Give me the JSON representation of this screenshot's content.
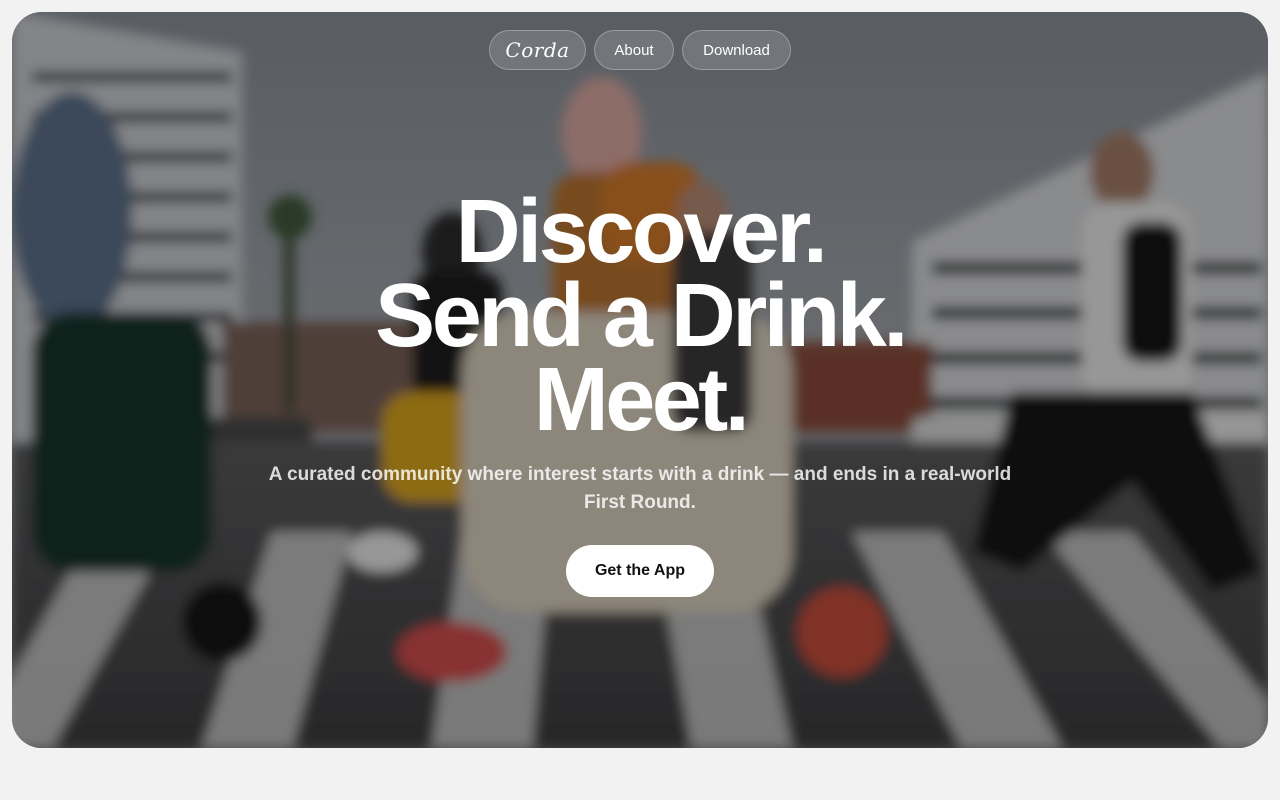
{
  "nav": {
    "logo_text": "Corda",
    "about_label": "About",
    "download_label": "Download"
  },
  "hero": {
    "headline_line1": "Discover.",
    "headline_line2": "Send a Drink.",
    "headline_line3": "Meet.",
    "subtitle": "A curated community where interest starts with a drink — and ends in a real-world First Round.",
    "cta_label": "Get the App",
    "background_image": "blurred photo of people crossing a city crosswalk"
  },
  "colors": {
    "page_background": "#f2f2f2",
    "headline_text": "#ffffff",
    "cta_background": "#ffffff",
    "cta_text": "#111111"
  }
}
